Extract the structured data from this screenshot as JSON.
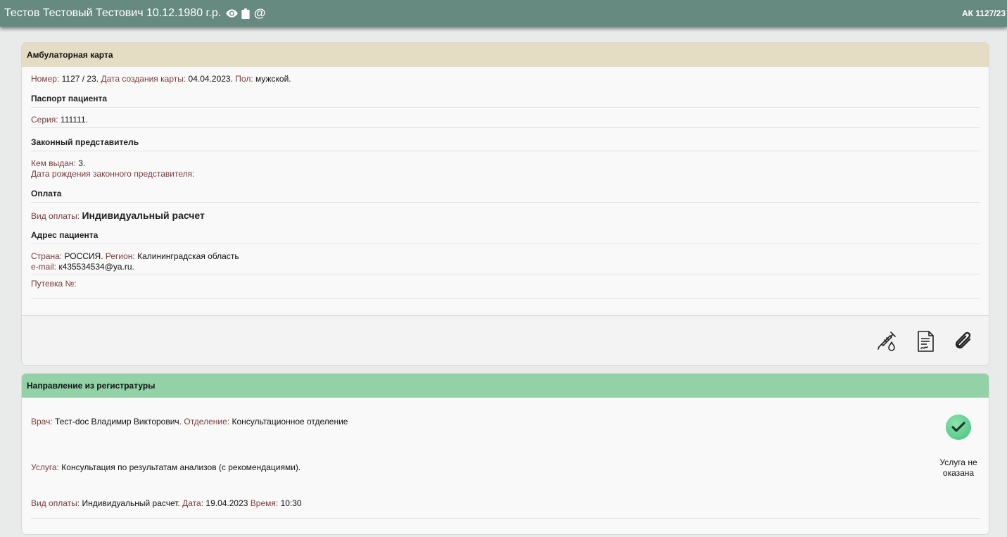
{
  "header": {
    "patient": "Тестов Тестовый Тестович 10.12.1980 г.р.",
    "card_code": "АК 1127/23",
    "icons": [
      "eye-icon",
      "clipboard-icon",
      "at-icon"
    ]
  },
  "card1": {
    "title": "Амбулаторная карта",
    "number_label": "Номер:",
    "number_value": "1127 / 23.",
    "created_label": "Дата создания карты:",
    "created_value": "04.04.2023.",
    "sex_label": "Пол:",
    "sex_value": "мужской.",
    "passport_title": "Паспорт пациента",
    "series_label": "Серия:",
    "series_value": "111111.",
    "rep_title": "Законный представитель",
    "issued_label": "Кем выдан:",
    "issued_value": "3.",
    "rep_birth_label": "Дата рождения законного представителя:",
    "payment_title": "Оплата",
    "pay_type_label": "Вид оплаты:",
    "pay_type_value": "Индивидуальный расчет",
    "address_title": "Адрес пациента",
    "country_label": "Страна:",
    "country_value": "РОССИЯ.",
    "region_label": "Регион:",
    "region_value": "Калининградская область",
    "email_label": "e-mail:",
    "email_value": "к435534534@ya.ru.",
    "voucher_label": "Путевка №:",
    "footer_icons": [
      "syringe-icon",
      "document-icon",
      "paperclip-icon"
    ]
  },
  "card2": {
    "title": "Направление из регистратуры",
    "doctor_label": "Врач:",
    "doctor_value": "Тест-doc Владимир Викторович.",
    "dept_label": "Отделение:",
    "dept_value": "Консультационное отделение",
    "service_label": "Услуга:",
    "service_value": "Консультация по результатам анализов (с рекомендациями).",
    "pay_label": "Вид оплаты:",
    "pay_value": "Индивидуальный расчет.",
    "date_label": "Дата:",
    "date_value": "19.04.2023",
    "time_label": "Время:",
    "time_value": "10:30",
    "status_text": "Услуга не оказана",
    "status_icon": "check-icon"
  }
}
